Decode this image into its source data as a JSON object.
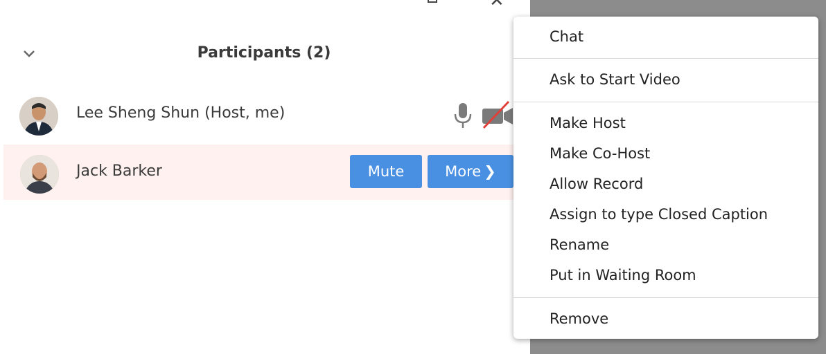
{
  "header": {
    "title": "Participants (2)"
  },
  "participants": [
    {
      "name": "Lee Sheng Shun (Host, me)"
    },
    {
      "name": "Jack Barker"
    }
  ],
  "actions": {
    "mute_label": "Mute",
    "more_label": "More",
    "more_chevron": "❯"
  },
  "menu": {
    "chat": "Chat",
    "ask_video": "Ask to Start Video",
    "make_host": "Make Host",
    "make_cohost": "Make Co-Host",
    "allow_record": "Allow Record",
    "assign_cc": "Assign to type Closed Caption",
    "rename": "Rename",
    "waiting_room": "Put in Waiting Room",
    "remove": "Remove"
  },
  "window": {
    "close_glyph": "✕"
  },
  "colors": {
    "accent": "#4a90e2",
    "highlight_row": "#fff1ef",
    "overlay": "#8c8c8c",
    "video_off_slash": "#e0403a"
  },
  "icons": [
    "chevron-down-icon",
    "microphone-icon",
    "video-off-icon",
    "restore-icon",
    "close-icon"
  ]
}
